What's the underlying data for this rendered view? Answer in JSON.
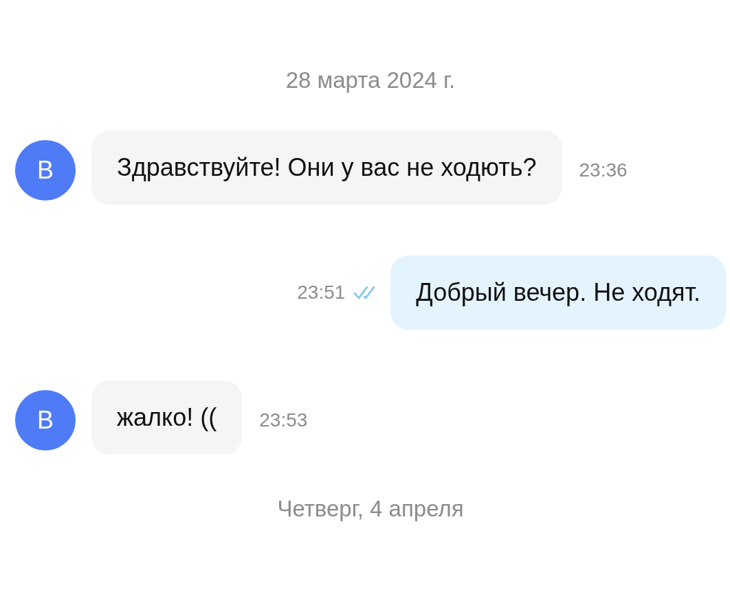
{
  "messages": [
    {
      "kind": "date",
      "text": "28 марта 2024 г."
    },
    {
      "kind": "incoming",
      "avatar": "В",
      "text": "Здравствуйте! Они у вас не ходють?",
      "time": "23:36"
    },
    {
      "kind": "outgoing",
      "text": "Добрый вечер. Не ходят.",
      "time": "23:51",
      "read": true
    },
    {
      "kind": "incoming",
      "avatar": "В",
      "text": "жалко! ((",
      "time": "23:53"
    },
    {
      "kind": "date",
      "text": "Четверг, 4 апреля"
    }
  ]
}
